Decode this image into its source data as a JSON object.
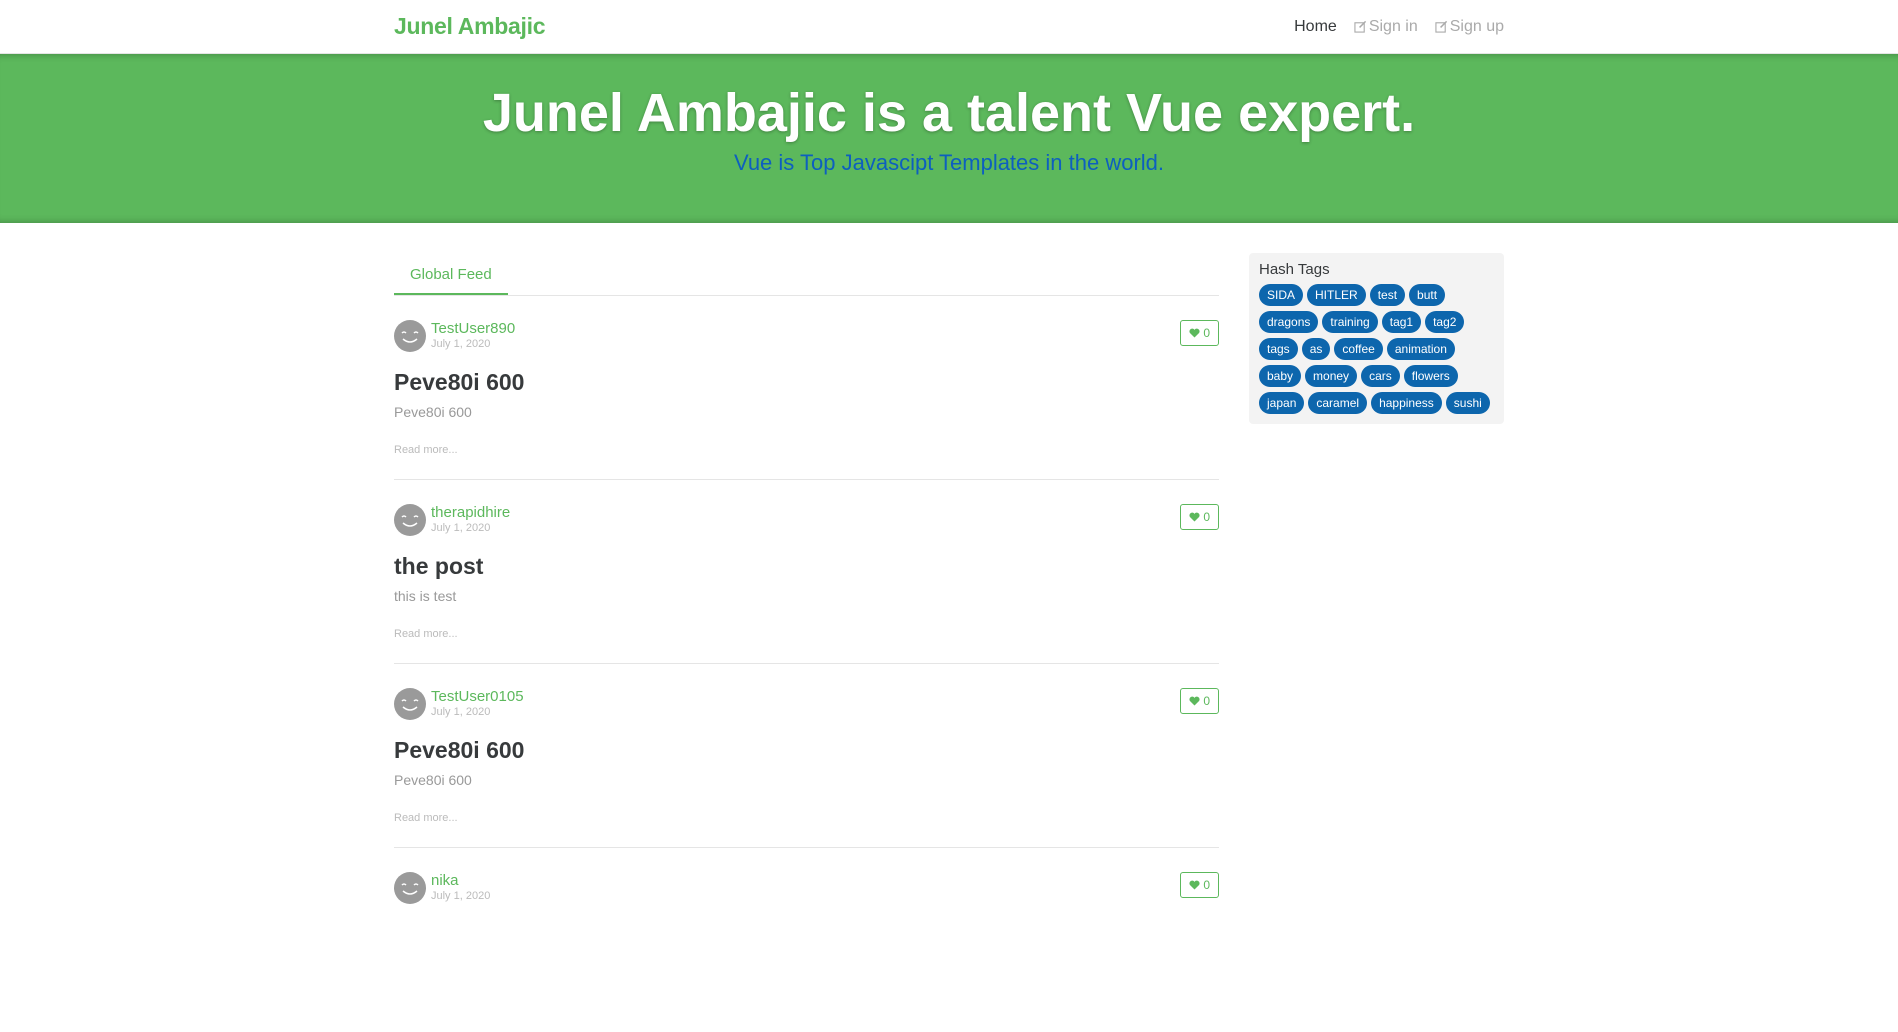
{
  "navbar": {
    "brand": "Junel Ambajic",
    "links": [
      {
        "label": "Home"
      },
      {
        "label": "Sign in"
      },
      {
        "label": "Sign up"
      }
    ]
  },
  "banner": {
    "title": "Junel Ambajic is a talent Vue expert.",
    "subtitle": "Vue is Top Javascipt Templates in the world."
  },
  "feed": {
    "tab": "Global Feed",
    "articles": [
      {
        "author": "TestUser890",
        "date": "July 1, 2020",
        "likes": "0",
        "title": "Peve80i 600",
        "description": "Peve80i 600",
        "read_more": "Read more..."
      },
      {
        "author": "therapidhire",
        "date": "July 1, 2020",
        "likes": "0",
        "title": "the post",
        "description": "this is test",
        "read_more": "Read more..."
      },
      {
        "author": "TestUser0105",
        "date": "July 1, 2020",
        "likes": "0",
        "title": "Peve80i 600",
        "description": "Peve80i 600",
        "read_more": "Read more..."
      },
      {
        "author": "nika",
        "date": "July 1, 2020",
        "likes": "0",
        "title": "",
        "description": "",
        "read_more": ""
      }
    ]
  },
  "sidebar": {
    "title": "Hash Tags",
    "tags": [
      "SIDA",
      "HITLER",
      "test",
      "butt",
      "dragons",
      "training",
      "tag1",
      "tag2",
      "tags",
      "as",
      "coffee",
      "animation",
      "baby",
      "money",
      "cars",
      "flowers",
      "japan",
      "caramel",
      "happiness",
      "sushi"
    ]
  },
  "colors": {
    "brand_green": "#5cb85c",
    "tag_blue": "#0d66ad",
    "subtitle_blue": "#0d5fbf"
  }
}
